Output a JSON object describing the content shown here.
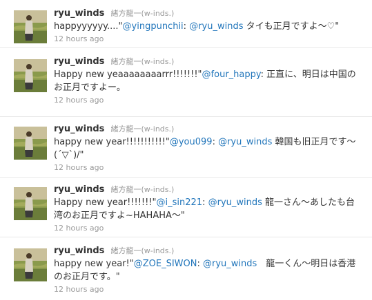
{
  "tweets": [
    {
      "screen_name": "ryu_winds",
      "full_name": "緒方龍一(w-inds.)",
      "text_before": "happyyyyyy....\"",
      "mention1": "@yingpunchii",
      "text_middle": ": ",
      "mention2": "@ryu_winds",
      "text_after": " タイも正月ですよ〜♡\"",
      "timestamp": "12 hours ago"
    },
    {
      "screen_name": "ryu_winds",
      "full_name": "緒方龍一(w-inds.)",
      "text_before": "Happy new yeaaaaaaaarrr!!!!!!!\"",
      "mention1": "@four_happy",
      "text_after": ": 正直に、明日は中国のお正月ですよー。",
      "timestamp": "12 hours ago"
    },
    {
      "screen_name": "ryu_winds",
      "full_name": "緒方龍一(w-inds.)",
      "text_before": "happy new year!!!!!!!!!!!\"",
      "mention1": "@you099",
      "text_middle": ": ",
      "mention2": "@ryu_winds",
      "text_after": " 韓国も旧正月です〜(´▽`)/\"",
      "timestamp": "12 hours ago"
    },
    {
      "screen_name": "ryu_winds",
      "full_name": "緒方龍一(w-inds.)",
      "text_before": "Happy new year!!!!!!!\"",
      "mention1": "@i_sin221",
      "text_middle": ": ",
      "mention2": "@ryu_winds",
      "text_after": " 龍一さん～あしたも台湾のお正月ですよ~HAHAHA〜\"",
      "timestamp": "12 hours ago"
    },
    {
      "screen_name": "ryu_winds",
      "full_name": "緒方龍一(w-inds.)",
      "text_before": "happy new year!\"",
      "mention1": "@ZOE_SIWON",
      "text_middle": ": ",
      "mention2": "@ryu_winds",
      "text_after": "　龍一くん～明日は香港のお正月です。\"",
      "timestamp": "12 hours ago"
    }
  ],
  "colors": {
    "link": "#2276bb",
    "meta": "#999999",
    "text": "#333333"
  },
  "icons": {
    "avatar": "profile-photo-person-in-field"
  }
}
